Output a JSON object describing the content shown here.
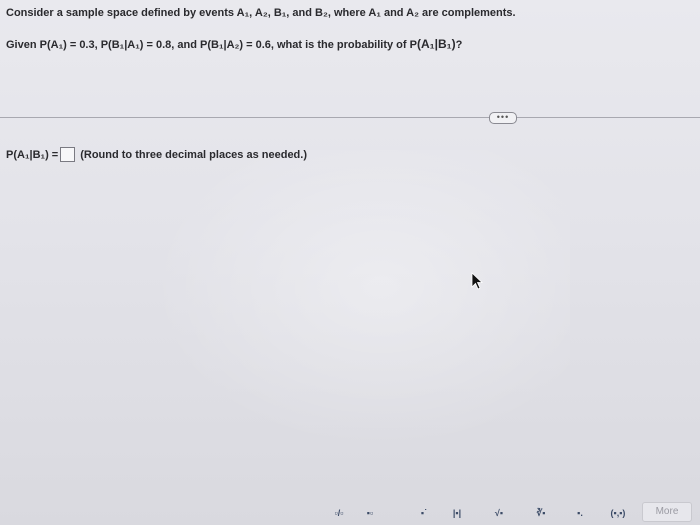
{
  "question": {
    "line1": "Consider a sample space defined by events A₁, A₂, B₁, and B₂, where A₁ and A₂ are complements.",
    "line2_given": "Given P(A₁) = 0.3, P(B₁|A₁) = 0.8, and P(B₁|A₂) = 0.6, what is the probability of P",
    "line2_target": "(A₁|B₁)",
    "line2_end": "?"
  },
  "divider": {
    "dots_label": "•••"
  },
  "answer": {
    "label": "P(A₁|B₁) =",
    "value": "",
    "hint": "(Round to three decimal places as needed.)"
  },
  "toolbar": {
    "buttons": [
      {
        "name": "fraction-button",
        "glyph": "▫/▫"
      },
      {
        "name": "mixed-number-button",
        "glyph": "▪▫"
      },
      {
        "name": "exponent-button",
        "glyph": "▪˙"
      },
      {
        "name": "absolute-value-button",
        "glyph": "|▪|"
      },
      {
        "name": "sqrt-button",
        "glyph": "√▪"
      },
      {
        "name": "nth-root-button",
        "glyph": "∛▪"
      },
      {
        "name": "decimal-button",
        "glyph": "▪."
      },
      {
        "name": "ordered-pair-button",
        "glyph": "(▪,▪)"
      }
    ],
    "more_label": "More"
  }
}
